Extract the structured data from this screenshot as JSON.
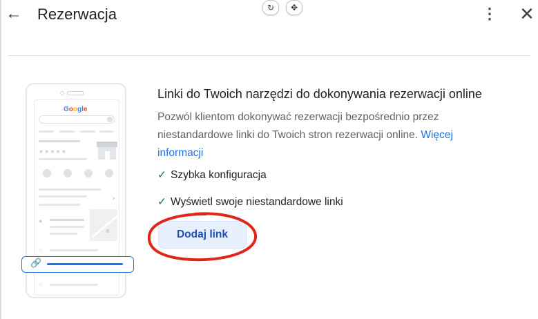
{
  "header": {
    "back_icon": "arrow-left-icon",
    "title": "Rezerwacja",
    "floating_controls": [
      "rotate-icon",
      "move-icon"
    ],
    "more_icon": "more-vert-icon",
    "close_icon": "close-icon"
  },
  "illustration": {
    "brand_text": "Google",
    "rating_stars": "★★★★★",
    "link_icon": "link-icon"
  },
  "content": {
    "heading": "Linki do Twoich narzędzi do dokonywania rezerwacji online",
    "description": "Pozwól klientom dokonywać rezerwacji bezpośrednio przez niestandardowe linki do Twoich stron rezerwacji online.",
    "learn_more_link": "Więcej informacji",
    "features": [
      "Szybka konfiguracja",
      "Wyświetl swoje niestandardowe linki"
    ],
    "add_link_button": "Dodaj link"
  },
  "colors": {
    "accent": "#1a73e8",
    "check": "#188038",
    "annotation": "#e0261b",
    "button_bg": "#e8f0fe"
  }
}
